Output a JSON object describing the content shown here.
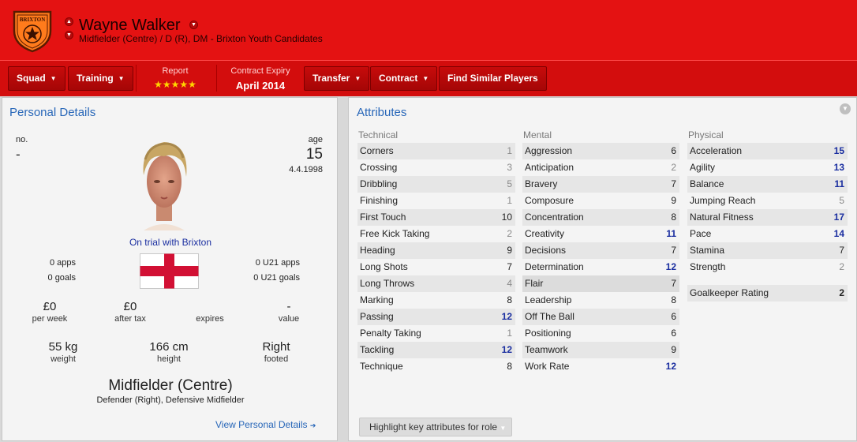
{
  "header": {
    "crest_text": "BRIXTON",
    "player_name": "Wayne Walker",
    "subtitle": "Midfielder (Centre) / D (R), DM - Brixton Youth Candidates"
  },
  "toolbar": {
    "squad": "Squad",
    "training": "Training",
    "report_label": "Report",
    "report_stars": "★★★★★",
    "contract_label": "Contract Expiry",
    "contract_value": "April 2014",
    "transfer": "Transfer",
    "contract": "Contract",
    "find_similar": "Find Similar Players"
  },
  "personal": {
    "title": "Personal Details",
    "no_label": "no.",
    "no_value": "-",
    "age_label": "age",
    "age_value": "15",
    "dob": "4.4.1998",
    "status": "On trial with Brixton",
    "apps": "0 apps",
    "goals": "0 goals",
    "u21_apps": "0 U21 apps",
    "u21_goals": "0 U21 goals",
    "per_week_value": "£0",
    "per_week_label": "per week",
    "after_tax_value": "£0",
    "after_tax_label": "after tax",
    "expires_label": "expires",
    "value_value": "-",
    "value_label": "value",
    "weight_value": "55 kg",
    "weight_label": "weight",
    "height_value": "166 cm",
    "height_label": "height",
    "foot_value": "Right",
    "foot_label": "footed",
    "position": "Midfielder (Centre)",
    "positions_secondary": "Defender (Right), Defensive Midfielder",
    "view_link": "View Personal Details"
  },
  "attributes": {
    "title": "Attributes",
    "technical_label": "Technical",
    "mental_label": "Mental",
    "physical_label": "Physical",
    "technical": [
      {
        "name": "Corners",
        "value": "1"
      },
      {
        "name": "Crossing",
        "value": "3"
      },
      {
        "name": "Dribbling",
        "value": "5"
      },
      {
        "name": "Finishing",
        "value": "1"
      },
      {
        "name": "First Touch",
        "value": "10"
      },
      {
        "name": "Free Kick Taking",
        "value": "2"
      },
      {
        "name": "Heading",
        "value": "9"
      },
      {
        "name": "Long Shots",
        "value": "7"
      },
      {
        "name": "Long Throws",
        "value": "4"
      },
      {
        "name": "Marking",
        "value": "8"
      },
      {
        "name": "Passing",
        "value": "12"
      },
      {
        "name": "Penalty Taking",
        "value": "1"
      },
      {
        "name": "Tackling",
        "value": "12"
      },
      {
        "name": "Technique",
        "value": "8"
      }
    ],
    "mental": [
      {
        "name": "Aggression",
        "value": "6"
      },
      {
        "name": "Anticipation",
        "value": "2"
      },
      {
        "name": "Bravery",
        "value": "7"
      },
      {
        "name": "Composure",
        "value": "9"
      },
      {
        "name": "Concentration",
        "value": "8"
      },
      {
        "name": "Creativity",
        "value": "11"
      },
      {
        "name": "Decisions",
        "value": "7"
      },
      {
        "name": "Determination",
        "value": "12"
      },
      {
        "name": "Flair",
        "value": "7"
      },
      {
        "name": "Leadership",
        "value": "8"
      },
      {
        "name": "Off The Ball",
        "value": "6"
      },
      {
        "name": "Positioning",
        "value": "6"
      },
      {
        "name": "Teamwork",
        "value": "9"
      },
      {
        "name": "Work Rate",
        "value": "12"
      }
    ],
    "physical": [
      {
        "name": "Acceleration",
        "value": "15"
      },
      {
        "name": "Agility",
        "value": "13"
      },
      {
        "name": "Balance",
        "value": "11"
      },
      {
        "name": "Jumping Reach",
        "value": "5"
      },
      {
        "name": "Natural Fitness",
        "value": "17"
      },
      {
        "name": "Pace",
        "value": "14"
      },
      {
        "name": "Stamina",
        "value": "7"
      },
      {
        "name": "Strength",
        "value": "2"
      }
    ],
    "goalkeeper_label": "Goalkeeper Rating",
    "goalkeeper_value": "2",
    "highlight_button": "Highlight key attributes for role"
  },
  "colors": {
    "header_red": "#e41212",
    "toolbar_red": "#d30d0d",
    "link_blue": "#2766b8",
    "high_value": "#1a2ea0"
  }
}
